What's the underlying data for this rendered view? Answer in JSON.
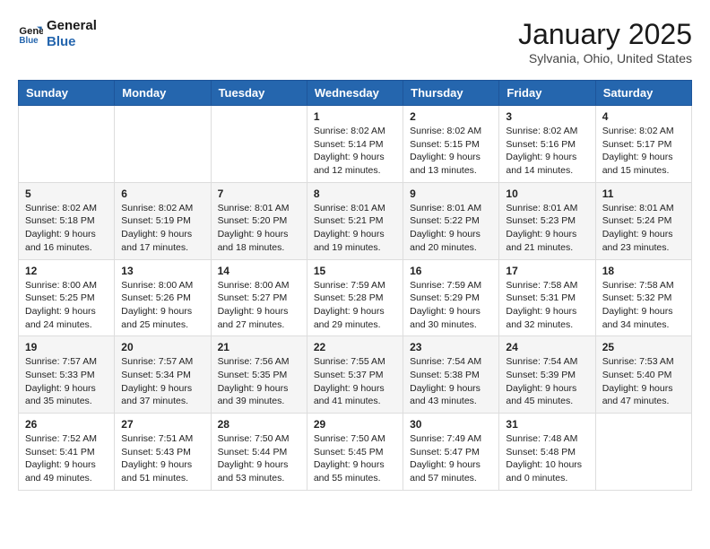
{
  "header": {
    "logo_line1": "General",
    "logo_line2": "Blue",
    "month_title": "January 2025",
    "location": "Sylvania, Ohio, United States"
  },
  "days_of_week": [
    "Sunday",
    "Monday",
    "Tuesday",
    "Wednesday",
    "Thursday",
    "Friday",
    "Saturday"
  ],
  "weeks": [
    [
      {
        "day": "",
        "info": ""
      },
      {
        "day": "",
        "info": ""
      },
      {
        "day": "",
        "info": ""
      },
      {
        "day": "1",
        "info": "Sunrise: 8:02 AM\nSunset: 5:14 PM\nDaylight: 9 hours\nand 12 minutes."
      },
      {
        "day": "2",
        "info": "Sunrise: 8:02 AM\nSunset: 5:15 PM\nDaylight: 9 hours\nand 13 minutes."
      },
      {
        "day": "3",
        "info": "Sunrise: 8:02 AM\nSunset: 5:16 PM\nDaylight: 9 hours\nand 14 minutes."
      },
      {
        "day": "4",
        "info": "Sunrise: 8:02 AM\nSunset: 5:17 PM\nDaylight: 9 hours\nand 15 minutes."
      }
    ],
    [
      {
        "day": "5",
        "info": "Sunrise: 8:02 AM\nSunset: 5:18 PM\nDaylight: 9 hours\nand 16 minutes."
      },
      {
        "day": "6",
        "info": "Sunrise: 8:02 AM\nSunset: 5:19 PM\nDaylight: 9 hours\nand 17 minutes."
      },
      {
        "day": "7",
        "info": "Sunrise: 8:01 AM\nSunset: 5:20 PM\nDaylight: 9 hours\nand 18 minutes."
      },
      {
        "day": "8",
        "info": "Sunrise: 8:01 AM\nSunset: 5:21 PM\nDaylight: 9 hours\nand 19 minutes."
      },
      {
        "day": "9",
        "info": "Sunrise: 8:01 AM\nSunset: 5:22 PM\nDaylight: 9 hours\nand 20 minutes."
      },
      {
        "day": "10",
        "info": "Sunrise: 8:01 AM\nSunset: 5:23 PM\nDaylight: 9 hours\nand 21 minutes."
      },
      {
        "day": "11",
        "info": "Sunrise: 8:01 AM\nSunset: 5:24 PM\nDaylight: 9 hours\nand 23 minutes."
      }
    ],
    [
      {
        "day": "12",
        "info": "Sunrise: 8:00 AM\nSunset: 5:25 PM\nDaylight: 9 hours\nand 24 minutes."
      },
      {
        "day": "13",
        "info": "Sunrise: 8:00 AM\nSunset: 5:26 PM\nDaylight: 9 hours\nand 25 minutes."
      },
      {
        "day": "14",
        "info": "Sunrise: 8:00 AM\nSunset: 5:27 PM\nDaylight: 9 hours\nand 27 minutes."
      },
      {
        "day": "15",
        "info": "Sunrise: 7:59 AM\nSunset: 5:28 PM\nDaylight: 9 hours\nand 29 minutes."
      },
      {
        "day": "16",
        "info": "Sunrise: 7:59 AM\nSunset: 5:29 PM\nDaylight: 9 hours\nand 30 minutes."
      },
      {
        "day": "17",
        "info": "Sunrise: 7:58 AM\nSunset: 5:31 PM\nDaylight: 9 hours\nand 32 minutes."
      },
      {
        "day": "18",
        "info": "Sunrise: 7:58 AM\nSunset: 5:32 PM\nDaylight: 9 hours\nand 34 minutes."
      }
    ],
    [
      {
        "day": "19",
        "info": "Sunrise: 7:57 AM\nSunset: 5:33 PM\nDaylight: 9 hours\nand 35 minutes."
      },
      {
        "day": "20",
        "info": "Sunrise: 7:57 AM\nSunset: 5:34 PM\nDaylight: 9 hours\nand 37 minutes."
      },
      {
        "day": "21",
        "info": "Sunrise: 7:56 AM\nSunset: 5:35 PM\nDaylight: 9 hours\nand 39 minutes."
      },
      {
        "day": "22",
        "info": "Sunrise: 7:55 AM\nSunset: 5:37 PM\nDaylight: 9 hours\nand 41 minutes."
      },
      {
        "day": "23",
        "info": "Sunrise: 7:54 AM\nSunset: 5:38 PM\nDaylight: 9 hours\nand 43 minutes."
      },
      {
        "day": "24",
        "info": "Sunrise: 7:54 AM\nSunset: 5:39 PM\nDaylight: 9 hours\nand 45 minutes."
      },
      {
        "day": "25",
        "info": "Sunrise: 7:53 AM\nSunset: 5:40 PM\nDaylight: 9 hours\nand 47 minutes."
      }
    ],
    [
      {
        "day": "26",
        "info": "Sunrise: 7:52 AM\nSunset: 5:41 PM\nDaylight: 9 hours\nand 49 minutes."
      },
      {
        "day": "27",
        "info": "Sunrise: 7:51 AM\nSunset: 5:43 PM\nDaylight: 9 hours\nand 51 minutes."
      },
      {
        "day": "28",
        "info": "Sunrise: 7:50 AM\nSunset: 5:44 PM\nDaylight: 9 hours\nand 53 minutes."
      },
      {
        "day": "29",
        "info": "Sunrise: 7:50 AM\nSunset: 5:45 PM\nDaylight: 9 hours\nand 55 minutes."
      },
      {
        "day": "30",
        "info": "Sunrise: 7:49 AM\nSunset: 5:47 PM\nDaylight: 9 hours\nand 57 minutes."
      },
      {
        "day": "31",
        "info": "Sunrise: 7:48 AM\nSunset: 5:48 PM\nDaylight: 10 hours\nand 0 minutes."
      },
      {
        "day": "",
        "info": ""
      }
    ]
  ]
}
